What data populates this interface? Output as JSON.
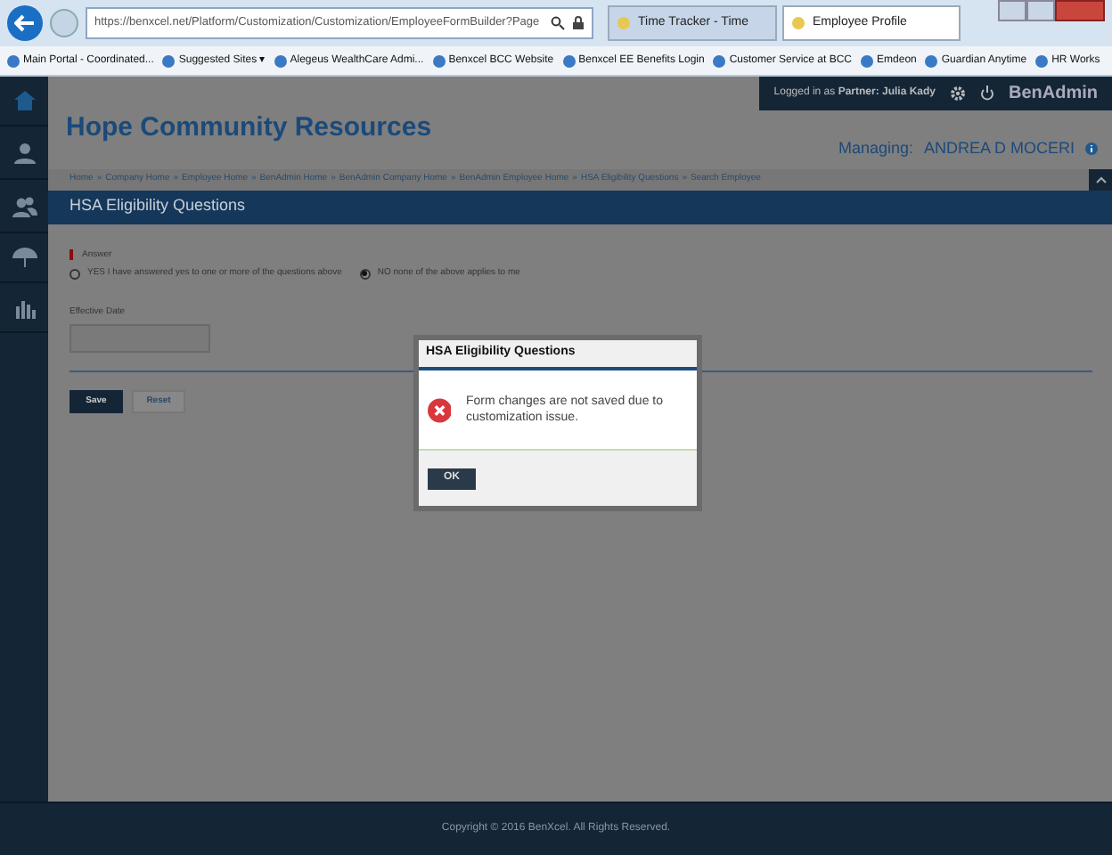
{
  "browser": {
    "url": "https://benxcel.net/Platform/Customization/Customization/EmployeeFormBuilder?Page",
    "tabs": [
      {
        "title": "Time Tracker - Time",
        "selected": false
      },
      {
        "title": "Employee Profile",
        "selected": true
      }
    ],
    "favorites": [
      {
        "label": "Main Portal - Coordinated..."
      },
      {
        "label": "Suggested Sites ▾"
      },
      {
        "label": "Alegeus WealthCare Admi..."
      },
      {
        "label": "Benxcel BCC Website"
      },
      {
        "label": "Benxcel EE Benefits Login"
      },
      {
        "label": "Customer Service at BCC"
      },
      {
        "label": "Emdeon"
      },
      {
        "label": "Guardian Anytime"
      },
      {
        "label": "HR Works"
      }
    ]
  },
  "header": {
    "logged_in": "Logged in as",
    "partner_label": "Partner:",
    "user": "Julia Kady",
    "app": "BenAdmin",
    "org": "Hope Community Resources",
    "managing_label": "Managing:",
    "managing_name": "ANDREA D MOCERI"
  },
  "breadcrumb_separator": "»",
  "breadcrumbs": [
    "Home",
    "Company Home",
    "Employee Home",
    "BenAdmin Home",
    "BenAdmin Company Home",
    "BenAdmin Employee Home",
    "HSA Eligibility Questions",
    "Search Employee"
  ],
  "section_title": "HSA Eligibility Questions",
  "form": {
    "answer_label": "Answer",
    "options": [
      {
        "label": "YES I have answered yes to one or more of the questions above",
        "selected": false
      },
      {
        "label": "NO none of the above applies to me",
        "selected": true
      }
    ],
    "date_label": "Effective Date",
    "buttons": [
      {
        "label": "Save",
        "kind": "primary"
      },
      {
        "label": "Reset",
        "kind": "secondary"
      }
    ]
  },
  "dialog": {
    "title": "HSA Eligibility Questions",
    "message": "Form changes are not saved due to customization issue.",
    "button": "OK"
  },
  "footer": "Copyright © 2016 BenXcel. All Rights Reserved."
}
